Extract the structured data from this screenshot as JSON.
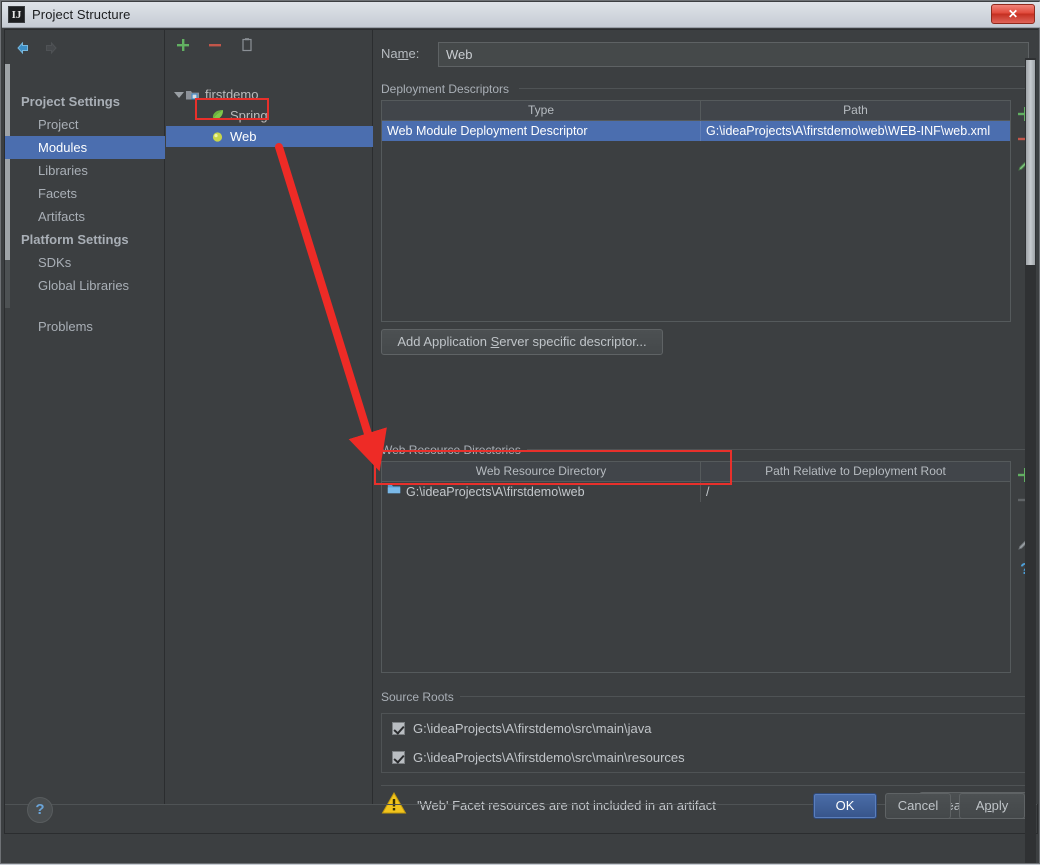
{
  "window": {
    "title": "Project Structure",
    "app_icon": "intellij-idea-icon",
    "close_label": "✕"
  },
  "sidebar": {
    "back_icon": "back-arrow-icon",
    "forward_icon": "forward-arrow-icon",
    "groups": [
      {
        "label": "Project Settings",
        "items": [
          {
            "label": "Project",
            "selected": false
          },
          {
            "label": "Modules",
            "selected": true
          },
          {
            "label": "Libraries",
            "selected": false
          },
          {
            "label": "Facets",
            "selected": false
          },
          {
            "label": "Artifacts",
            "selected": false
          }
        ]
      },
      {
        "label": "Platform Settings",
        "items": [
          {
            "label": "SDKs",
            "selected": false
          },
          {
            "label": "Global Libraries",
            "selected": false
          }
        ]
      }
    ],
    "problems_label": "Problems"
  },
  "tree": {
    "toolbar": [
      {
        "name": "add-module-button",
        "icon": "plus-icon"
      },
      {
        "name": "remove-module-button",
        "icon": "minus-icon"
      },
      {
        "name": "copy-module-button",
        "icon": "copy-icon"
      }
    ],
    "nodes": [
      {
        "label": "firstdemo",
        "icon": "module-icon",
        "level": 0,
        "expanded": true,
        "selected": false
      },
      {
        "label": "Spring",
        "icon": "spring-leaf-icon",
        "level": 1,
        "expanded": false,
        "selected": false
      },
      {
        "label": "Web",
        "icon": "web-facet-icon",
        "level": 1,
        "expanded": false,
        "selected": true
      }
    ]
  },
  "content": {
    "name_label_pre": "Na",
    "name_label_mnemonic": "m",
    "name_label_post": "e:",
    "name_value": "Web",
    "name_placeholder": "",
    "deployment_descriptors": {
      "group_label": "Deployment Descriptors",
      "columns": [
        "Type",
        "Path"
      ],
      "rows": [
        {
          "type": "Web Module Deployment Descriptor",
          "path": "G:\\ideaProjects\\A\\firstdemo\\web\\WEB-INF\\web.xml",
          "selected": true
        }
      ],
      "tools": [
        {
          "name": "add-descriptor-button",
          "icon": "plus-icon"
        },
        {
          "name": "remove-descriptor-button",
          "icon": "minus-icon"
        },
        {
          "name": "edit-descriptor-button",
          "icon": "pencil-icon"
        }
      ]
    },
    "add_descriptor_button": {
      "pre": "Add Application ",
      "mnemonic": "S",
      "post": "erver specific descriptor..."
    },
    "web_resource_directories": {
      "group_label": "Web Resource Directories",
      "columns": [
        "Web Resource Directory",
        "Path Relative to Deployment Root"
      ],
      "rows": [
        {
          "directory": "G:\\ideaProjects\\A\\firstdemo\\web",
          "relative": "/",
          "icon": "folder-icon",
          "selected": false
        }
      ],
      "tools": [
        {
          "name": "add-web-resource-button",
          "icon": "plus-icon"
        },
        {
          "name": "remove-web-resource-button",
          "icon": "minus-icon"
        },
        {
          "name": "edit-web-resource-button",
          "icon": "pencil-icon"
        },
        {
          "name": "help-web-resource-button",
          "icon": "question-icon"
        }
      ]
    },
    "source_roots": {
      "group_label": "Source Roots",
      "items": [
        {
          "label": "G:\\ideaProjects\\A\\firstdemo\\src\\main\\java",
          "checked": true
        },
        {
          "label": "G:\\ideaProjects\\A\\firstdemo\\src\\main\\resources",
          "checked": true
        }
      ]
    },
    "warning": {
      "icon": "warning-triangle-icon",
      "text": "'Web' Facet resources are not included in an artifact",
      "action_pre": "Create Arti",
      "action_mnemonic": "f",
      "action_post": "act"
    }
  },
  "footer": {
    "help_icon": "question-mark-icon",
    "ok_label": "OK",
    "cancel_label": "Cancel",
    "apply_pre": "A",
    "apply_mnemonic": "p",
    "apply_post": "ply"
  },
  "annotations": {
    "highlight_web_node": true,
    "highlight_web_resource_row": true,
    "arrow_color": "#ee2b26"
  },
  "colors": {
    "accent_selection": "#4b6eaf",
    "window_bg": "#3c3f41",
    "text": "#b6bbc0",
    "annotation_red": "#e8302b",
    "plus_green": "#5aa85a",
    "minus_red": "#c2564a",
    "warning_yellow": "#f0c020"
  }
}
